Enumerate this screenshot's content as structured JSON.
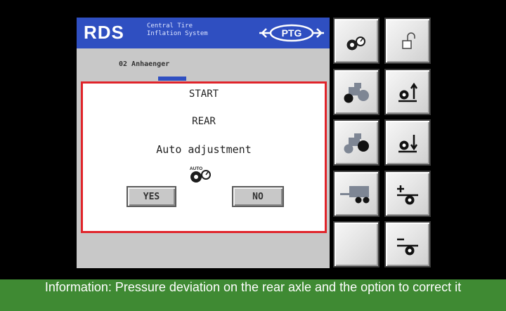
{
  "header": {
    "brand": "RDS",
    "subtitle_line1": "Central Tire",
    "subtitle_line2": "Inflation System",
    "logo": "PTG"
  },
  "selected_unit": "02 Anhaenger",
  "dialog": {
    "line1": "START",
    "line2": "REAR",
    "line3": "Auto adjustment",
    "icon_text": "AUTO",
    "yes_label": "YES",
    "no_label": "NO"
  },
  "side_buttons": {
    "left": [
      "tire-gauge-icon",
      "tractor-front-axle-icon",
      "tractor-rear-axle-icon",
      "trailer-icon",
      "empty"
    ],
    "right": [
      "lock-icon",
      "pressure-up-icon",
      "pressure-down-icon",
      "pressure-plus-icon",
      "pressure-minus-icon"
    ]
  },
  "caption": "Information: Pressure deviation on the rear axle and the option to correct it",
  "colors": {
    "header_blue": "#2f4fc1",
    "dialog_border": "#e0242a",
    "caption_green": "#3f8a33"
  }
}
